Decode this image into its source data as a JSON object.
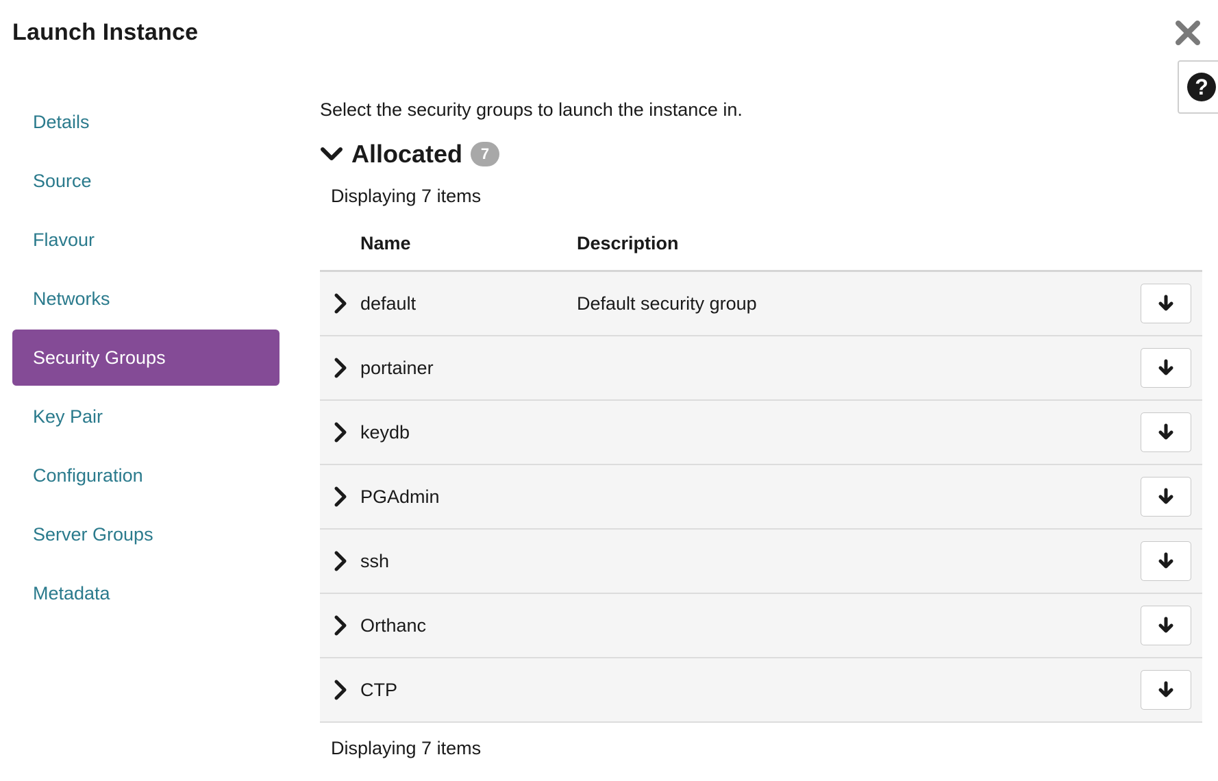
{
  "modal": {
    "title": "Launch Instance",
    "close_icon": "close-icon",
    "help_icon": "help-icon",
    "help_glyph": "?"
  },
  "nav": {
    "items": [
      {
        "label": "Details",
        "active": false
      },
      {
        "label": "Source",
        "active": false
      },
      {
        "label": "Flavour",
        "active": false
      },
      {
        "label": "Networks",
        "active": false
      },
      {
        "label": "Security Groups",
        "active": true
      },
      {
        "label": "Key Pair",
        "active": false
      },
      {
        "label": "Configuration",
        "active": false
      },
      {
        "label": "Server Groups",
        "active": false
      },
      {
        "label": "Metadata",
        "active": false
      }
    ],
    "active_color": "#844b96",
    "link_color": "#2a7a8c"
  },
  "main": {
    "intro": "Select the security groups to launch the instance in.",
    "allocated": {
      "title": "Allocated",
      "count": "7",
      "displaying_top": "Displaying 7 items",
      "displaying_bottom": "Displaying 7 items",
      "columns": [
        "Name",
        "Description"
      ],
      "rows": [
        {
          "name": "default",
          "description": "Default security group"
        },
        {
          "name": "portainer",
          "description": ""
        },
        {
          "name": "keydb",
          "description": ""
        },
        {
          "name": "PGAdmin",
          "description": ""
        },
        {
          "name": "ssh",
          "description": ""
        },
        {
          "name": "Orthanc",
          "description": ""
        },
        {
          "name": "CTP",
          "description": ""
        }
      ],
      "row_icons": {
        "expand": "chevron-right-icon",
        "move": "arrow-down-icon"
      }
    }
  }
}
